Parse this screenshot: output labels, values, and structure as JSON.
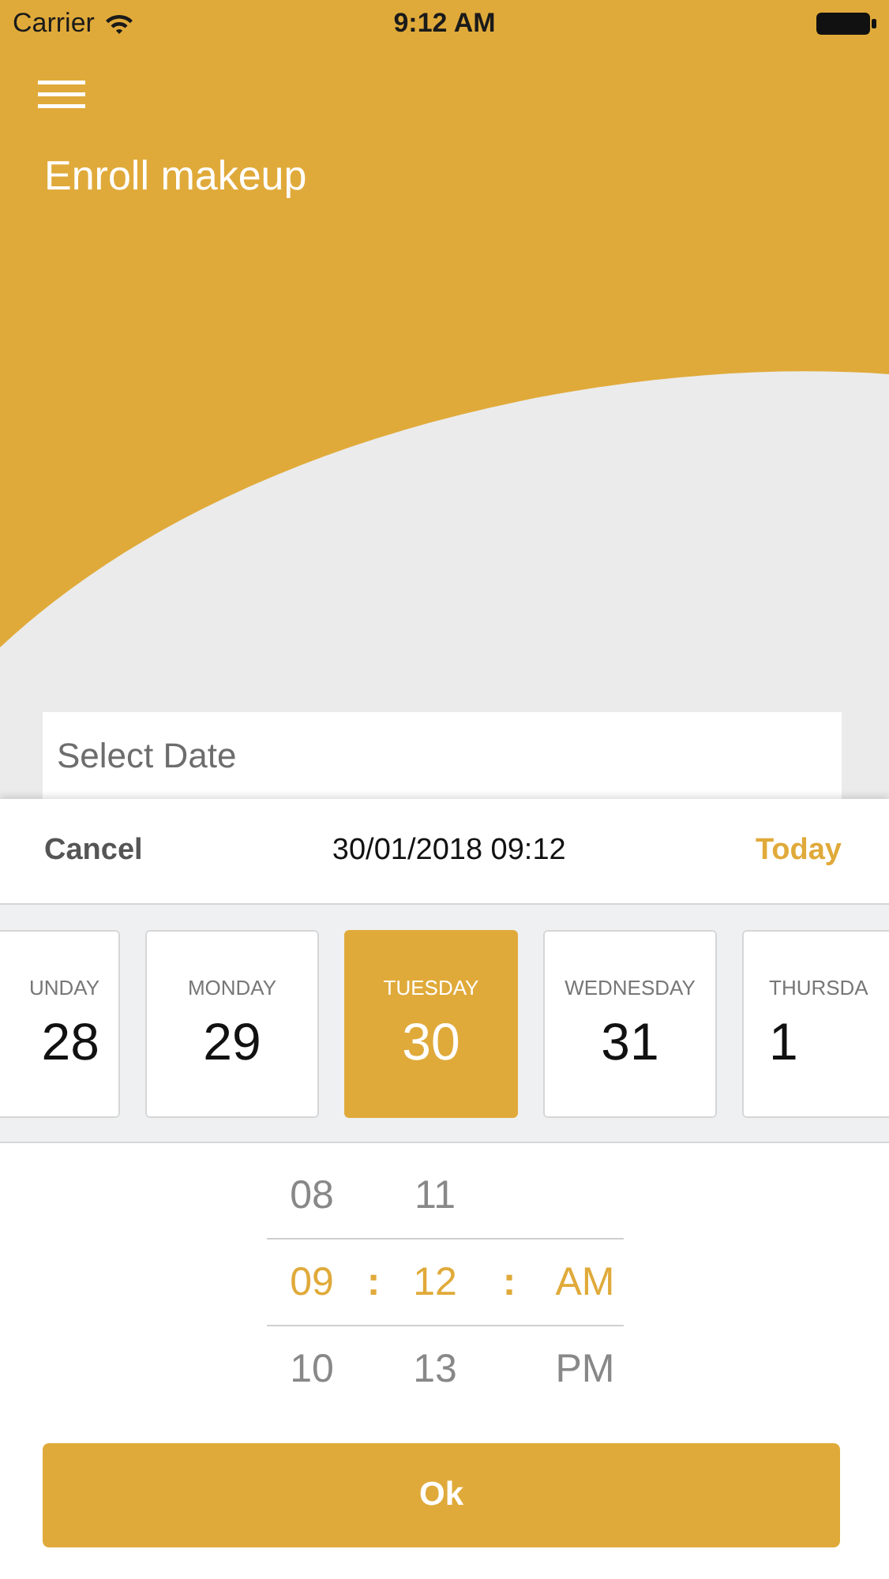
{
  "status_bar": {
    "carrier": "Carrier",
    "time": "9:12 AM"
  },
  "header": {
    "title": "Enroll makeup"
  },
  "date_field": {
    "placeholder": "Select Date"
  },
  "picker": {
    "cancel": "Cancel",
    "current": "30/01/2018 09:12",
    "today": "Today",
    "days": [
      {
        "weekday": "UNDAY",
        "date": "28",
        "selected": false
      },
      {
        "weekday": "MONDAY",
        "date": "29",
        "selected": false
      },
      {
        "weekday": "TUESDAY",
        "date": "30",
        "selected": true
      },
      {
        "weekday": "WEDNESDAY",
        "date": "31",
        "selected": false
      },
      {
        "weekday": "THURSDA",
        "date": "1",
        "selected": false
      }
    ],
    "hours": [
      {
        "label": "08",
        "selected": false
      },
      {
        "label": "09",
        "selected": true
      },
      {
        "label": "10",
        "selected": false
      }
    ],
    "minutes": [
      {
        "label": "11",
        "selected": false
      },
      {
        "label": "12",
        "selected": true
      },
      {
        "label": "13",
        "selected": false
      }
    ],
    "periods": [
      {
        "label": "AM",
        "selected": true
      },
      {
        "label": "PM",
        "selected": false
      }
    ],
    "separators": [
      ":",
      ":"
    ],
    "ok": "Ok"
  }
}
